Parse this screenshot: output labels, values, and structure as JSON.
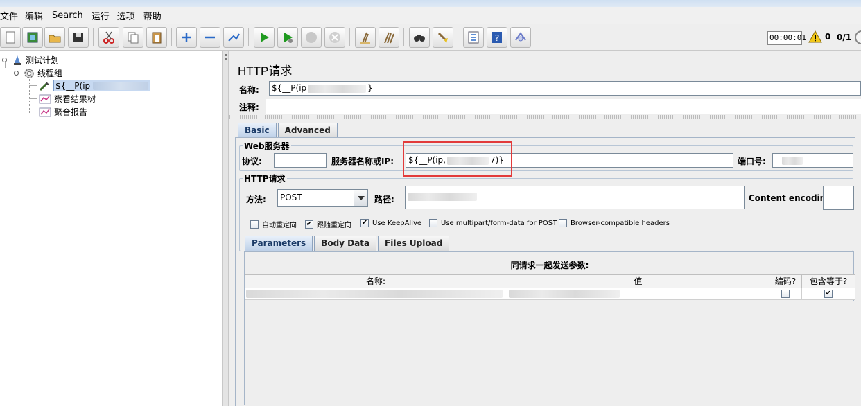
{
  "menu": {
    "items": [
      "文件",
      "编辑",
      "Search",
      "运行",
      "选项",
      "帮助"
    ]
  },
  "toolbar": {
    "buttons": [
      {
        "name": "new-icon"
      },
      {
        "name": "templates-icon"
      },
      {
        "name": "open-icon"
      },
      {
        "name": "save-icon"
      },
      {
        "name": "cut-icon"
      },
      {
        "name": "copy-icon"
      },
      {
        "name": "paste-icon"
      },
      {
        "name": "expand-icon"
      },
      {
        "name": "collapse-icon"
      },
      {
        "name": "toggle-icon"
      },
      {
        "name": "start-icon"
      },
      {
        "name": "start-no-pause-icon"
      },
      {
        "name": "stop-icon"
      },
      {
        "name": "shutdown-icon"
      },
      {
        "name": "clear-icon"
      },
      {
        "name": "clear-all-icon"
      },
      {
        "name": "search-icon"
      },
      {
        "name": "reset-search-icon"
      },
      {
        "name": "function-helper-icon"
      },
      {
        "name": "help-icon"
      },
      {
        "name": "remote-icon"
      }
    ],
    "timer": "00:00:01",
    "warning_count": "0",
    "thread_count": "0/1"
  },
  "tree": {
    "test_plan": "测试计划",
    "thread_group": "线程组",
    "sampler": "${__P(ip",
    "listener_tree": "察看结果树",
    "listener_report": "聚合报告"
  },
  "panel": {
    "title": "HTTP请求",
    "name_label": "名称:",
    "name_value": "${__P(ip",
    "name_value_end": "}",
    "comment_label": "注释:",
    "comment_value": ""
  },
  "tabs": {
    "basic": "Basic",
    "advanced": "Advanced"
  },
  "web_server": {
    "legend": "Web服务器",
    "protocol_label": "协议:",
    "protocol_value": "",
    "server_label": "服务器名称或IP:",
    "server_value_start": "${__P(ip,",
    "server_value_end": "7)}",
    "port_label": "端口号:"
  },
  "http_request": {
    "legend": "HTTP请求",
    "method_label": "方法:",
    "method_value": "POST",
    "path_label": "路径:",
    "encoding_label": "Content encoding:"
  },
  "checkboxes": [
    {
      "label": "自动重定向",
      "checked": false,
      "mark": ""
    },
    {
      "label": "跟随重定向",
      "checked": true,
      "mark": "✔"
    },
    {
      "label": "Use KeepAlive",
      "checked": true,
      "mark": "✔"
    },
    {
      "label": "Use multipart/form-data for POST",
      "checked": false,
      "mark": ""
    },
    {
      "label": "Browser-compatible headers",
      "checked": false,
      "mark": ""
    }
  ],
  "subtabs": {
    "parameters": "Parameters",
    "body_data": "Body Data",
    "files_upload": "Files Upload"
  },
  "params_table": {
    "title": "同请求一起发送参数:",
    "columns": [
      "名称:",
      "值",
      "编码?",
      "包含等于?"
    ],
    "row": {
      "encode_mark": "",
      "include_equals_mark": "✔"
    }
  },
  "colors": {
    "highlight": "#e23b3b",
    "tab_active": "#bdd0e8",
    "selection": "#c7d9f1"
  }
}
